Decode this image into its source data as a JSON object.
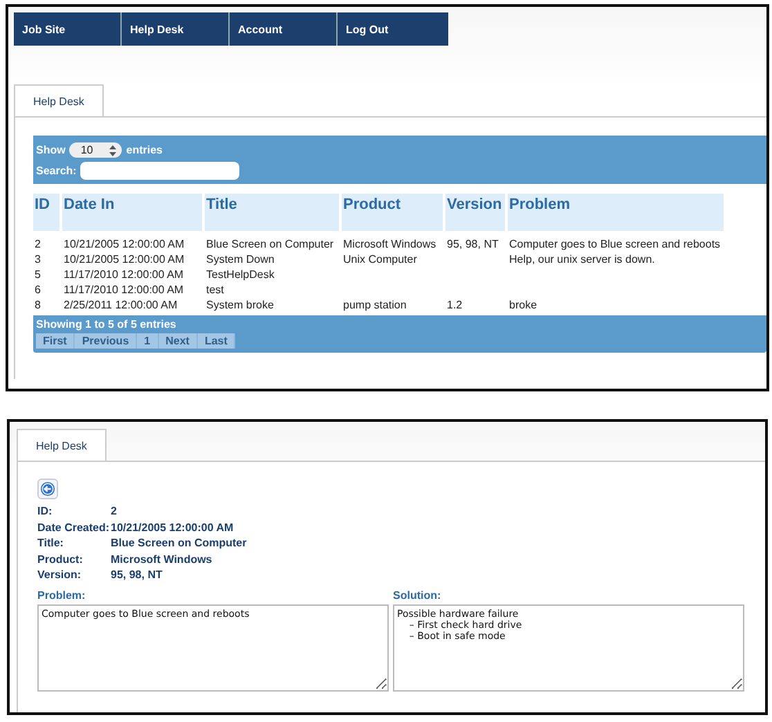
{
  "nav": [
    {
      "label": "Job Site"
    },
    {
      "label": "Help Desk"
    },
    {
      "label": "Account"
    },
    {
      "label": "Log Out"
    }
  ],
  "list_panel": {
    "tabs": [
      {
        "label": "Help Desk",
        "selected": true
      }
    ],
    "length": {
      "prefix": "Show",
      "value": "10",
      "suffix": "entries"
    },
    "search": {
      "label": "Search:"
    },
    "table": {
      "columns": [
        "ID",
        "Date In",
        "Title",
        "Product",
        "Version",
        "Problem"
      ],
      "rows": [
        [
          "2",
          "10/21/2005 12:00:00 AM",
          "Blue Screen on Computer",
          "Microsoft Windows",
          "95, 98, NT",
          "Computer goes to Blue screen and reboots"
        ],
        [
          "3",
          "10/21/2005 12:00:00 AM",
          "System Down",
          "Unix Computer",
          "",
          "Help, our unix server is down."
        ],
        [
          "5",
          "11/17/2010 12:00:00 AM",
          "TestHelpDesk",
          "",
          "",
          ""
        ],
        [
          "6",
          "11/17/2010 12:00:00 AM",
          "test",
          "",
          "",
          ""
        ],
        [
          "8",
          "2/25/2011 12:00:00 AM",
          "System broke",
          "pump station",
          "1.2",
          "broke"
        ]
      ]
    },
    "info": "Showing 1 to 5 of 5 entries",
    "pages": [
      {
        "label": "First",
        "disabled": true
      },
      {
        "label": "Previous",
        "disabled": true
      },
      {
        "label": "1",
        "disabled": true
      },
      {
        "label": "Next",
        "disabled": true
      },
      {
        "label": "Last",
        "disabled": true
      }
    ]
  },
  "detail_panel": {
    "tabs": [
      {
        "label": "Help Desk",
        "selected": true
      }
    ],
    "fields": [
      {
        "label": "ID:",
        "value": "2"
      },
      {
        "label": "Date Created:",
        "value": "10/21/2005 12:00:00 AM"
      },
      {
        "label": "Title:",
        "value": "Blue Screen on Computer"
      },
      {
        "label": "Product:",
        "value": "Microsoft Windows"
      },
      {
        "label": "Version:",
        "value": "95, 98, NT"
      }
    ],
    "areas": [
      {
        "label": "Problem:",
        "value": "Computer goes to Blue screen and reboots"
      },
      {
        "label": "Solution:",
        "value": "Possible hardware failure\n    – First check hard drive\n    – Boot in safe mode"
      }
    ]
  }
}
